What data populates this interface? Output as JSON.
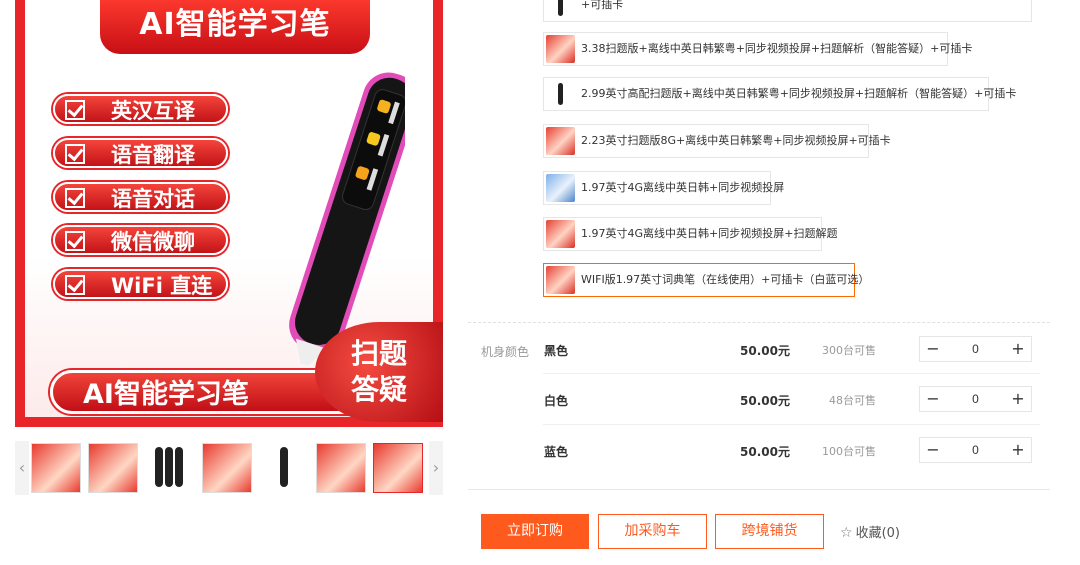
{
  "gallery": {
    "top_banner": "AI智能学习笔",
    "features": [
      "英汉互译",
      "语音翻译",
      "语音对话",
      "微信微聊",
      "WiFi 直连"
    ],
    "bottom_banner": "AI智能学习笔",
    "badge_line1": "扫题",
    "badge_line2": "答疑",
    "thumb_prev": "‹",
    "thumb_next": "›",
    "colors": {
      "brand_red": "#e8262a",
      "pen_body": "#1a1a1a",
      "pen_trim": "#e24cb8"
    }
  },
  "variants": [
    {
      "label": "+可插卡",
      "image": "pen"
    },
    {
      "label": "3.38扫题版+离线中英日韩繁粤+同步视频投屏+扫题解析（智能答疑）+可插卡",
      "image": "red"
    },
    {
      "label": "2.99英寸高配扫题版+离线中英日韩繁粤+同步视频投屏+扫题解析（智能答疑）+可插卡",
      "image": "pen"
    },
    {
      "label": "2.23英寸扫题版8G+离线中英日韩繁粤+同步视频投屏+可插卡",
      "image": "red"
    },
    {
      "label": "1.97英寸4G离线中英日韩+同步视频投屏",
      "image": "blue"
    },
    {
      "label": "1.97英寸4G离线中英日韩+同步视频投屏+扫题解题",
      "image": "red"
    },
    {
      "label": "WIFI版1.97英寸词典笔（在线使用）+可插卡（白蓝可选）",
      "image": "red",
      "selected": true
    }
  ],
  "color_section_label": "机身颜色",
  "color_rows": [
    {
      "name": "黑色",
      "price": "50.00元",
      "stock": "300台可售",
      "qty": "0"
    },
    {
      "name": "白色",
      "price": "50.00元",
      "stock": "48台可售",
      "qty": "0"
    },
    {
      "name": "蓝色",
      "price": "50.00元",
      "stock": "100台可售",
      "qty": "0"
    }
  ],
  "stepper": {
    "minus": "−",
    "plus": "+"
  },
  "actions": {
    "buy": "立即订购",
    "cart": "加采购车",
    "crossborder": "跨境铺货",
    "favorite": "收藏(0)",
    "accent": "#ff5a1e"
  }
}
